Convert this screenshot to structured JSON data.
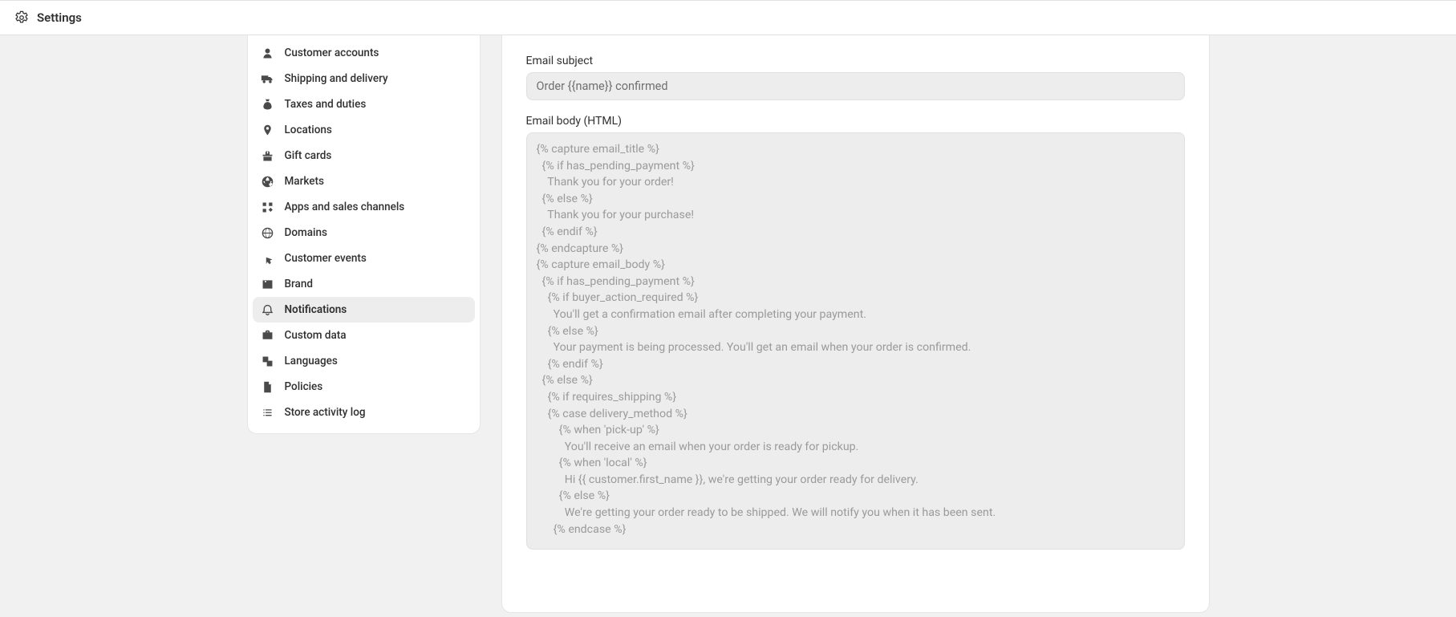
{
  "header": {
    "title": "Settings"
  },
  "sidebar": {
    "items": [
      {
        "id": "customer-accounts",
        "label": "Customer accounts",
        "icon": "user-icon"
      },
      {
        "id": "shipping",
        "label": "Shipping and delivery",
        "icon": "truck-icon"
      },
      {
        "id": "taxes",
        "label": "Taxes and duties",
        "icon": "moneybag-icon"
      },
      {
        "id": "locations",
        "label": "Locations",
        "icon": "pin-icon"
      },
      {
        "id": "giftcards",
        "label": "Gift cards",
        "icon": "gift-icon"
      },
      {
        "id": "markets",
        "label": "Markets",
        "icon": "globe-dollar-icon"
      },
      {
        "id": "apps",
        "label": "Apps and sales channels",
        "icon": "apps-icon"
      },
      {
        "id": "domains",
        "label": "Domains",
        "icon": "globe-icon"
      },
      {
        "id": "events",
        "label": "Customer events",
        "icon": "cursor-click-icon"
      },
      {
        "id": "brand",
        "label": "Brand",
        "icon": "image-icon"
      },
      {
        "id": "notifications",
        "label": "Notifications",
        "icon": "bell-icon"
      },
      {
        "id": "customdata",
        "label": "Custom data",
        "icon": "briefcase-icon"
      },
      {
        "id": "languages",
        "label": "Languages",
        "icon": "translate-icon"
      },
      {
        "id": "policies",
        "label": "Policies",
        "icon": "document-icon"
      },
      {
        "id": "activity",
        "label": "Store activity log",
        "icon": "list-icon"
      }
    ],
    "active": "notifications"
  },
  "main": {
    "subject_label": "Email subject",
    "subject_value": "Order {{name}} confirmed",
    "body_label": "Email body (HTML)",
    "body_value": "{% capture email_title %}\n  {% if has_pending_payment %}\n    Thank you for your order!\n  {% else %}\n    Thank you for your purchase!\n  {% endif %}\n{% endcapture %}\n{% capture email_body %}\n  {% if has_pending_payment %}\n    {% if buyer_action_required %}\n      You'll get a confirmation email after completing your payment.\n    {% else %}\n      Your payment is being processed. You'll get an email when your order is confirmed.\n    {% endif %}\n  {% else %}\n    {% if requires_shipping %}\n    {% case delivery_method %}\n        {% when 'pick-up' %}\n          You'll receive an email when your order is ready for pickup.\n        {% when 'local' %}\n          Hi {{ customer.first_name }}, we're getting your order ready for delivery.\n        {% else %}\n          We're getting your order ready to be shipped. We will notify you when it has been sent.\n      {% endcase %}\n"
  }
}
